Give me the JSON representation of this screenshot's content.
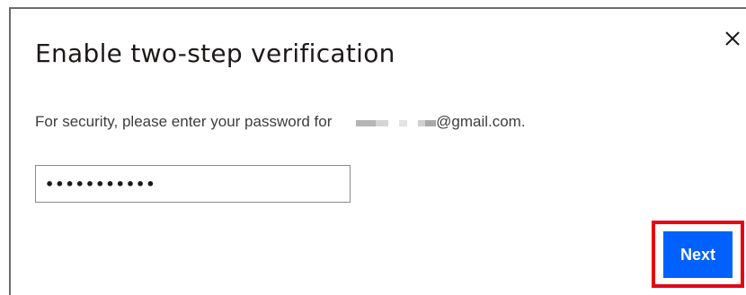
{
  "dialog": {
    "title": "Enable two-step verification",
    "close_icon": "close-icon",
    "description": {
      "prefix": "For security, please enter your password for",
      "email_suffix": "@gmail.com."
    },
    "password": {
      "value": "•••••••••••"
    },
    "next_label": "Next"
  },
  "colors": {
    "primary_button": "#0061fe",
    "highlight_border": "#e30613",
    "title_text": "#1e1919"
  }
}
